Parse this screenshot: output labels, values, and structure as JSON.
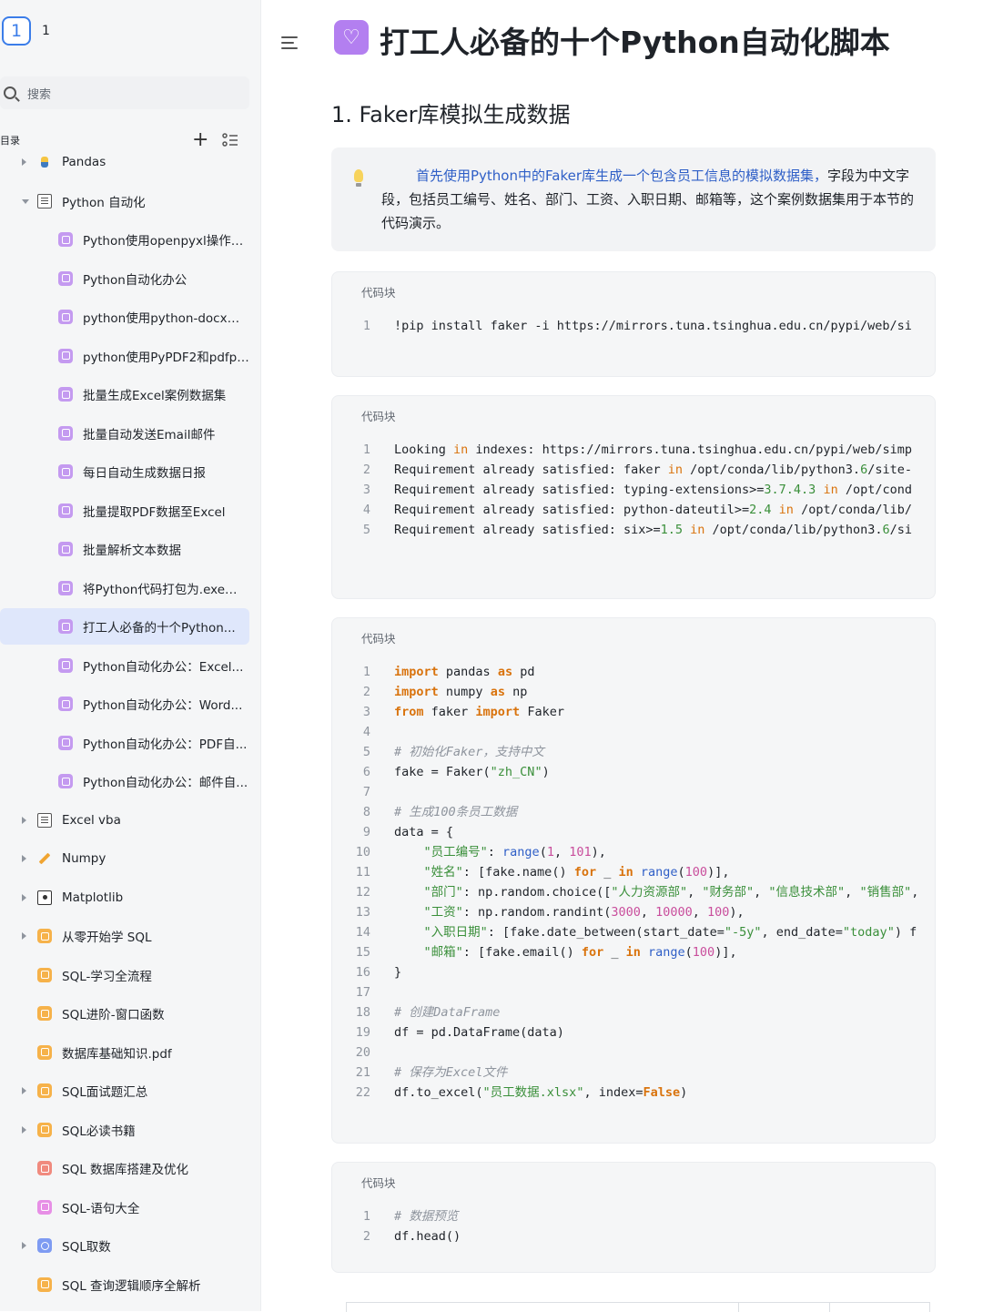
{
  "workspace": {
    "badge": "1",
    "name": "1"
  },
  "search": {
    "placeholder": "搜索"
  },
  "directory": {
    "label": "目录"
  },
  "tree": [
    {
      "label": "Pandas",
      "icon": "python-icon",
      "arrow": "right",
      "indent": 0
    },
    {
      "label": "Python 自动化",
      "icon": "doc-icon",
      "arrow": "down",
      "indent": 0
    },
    {
      "label": "Python使用openpyxl操作e...",
      "icon": "purple-page-icon",
      "indent": 1
    },
    {
      "label": "Python自动化办公",
      "icon": "purple-page-icon",
      "indent": 1
    },
    {
      "label": "python使用python-docx操...",
      "icon": "purple-page-icon",
      "indent": 1
    },
    {
      "label": "python使用PyPDF2和pdfpl...",
      "icon": "purple-page-icon",
      "indent": 1
    },
    {
      "label": "批量生成Excel案例数据集",
      "icon": "purple-page-icon",
      "indent": 1
    },
    {
      "label": "批量自动发送Email邮件",
      "icon": "purple-page-icon",
      "indent": 1
    },
    {
      "label": "每日自动生成数据日报",
      "icon": "purple-page-icon",
      "indent": 1
    },
    {
      "label": "批量提取PDF数据至Excel",
      "icon": "purple-page-icon",
      "indent": 1
    },
    {
      "label": "批量解析文本数据",
      "icon": "purple-page-icon",
      "indent": 1
    },
    {
      "label": "将Python代码打包为.exe程序",
      "icon": "purple-page-icon",
      "indent": 1
    },
    {
      "label": "打工人必备的十个Python...",
      "icon": "purple-page-icon",
      "indent": 1,
      "active": true
    },
    {
      "label": "Python自动化办公：Excel...",
      "icon": "purple-page-icon",
      "indent": 1
    },
    {
      "label": "Python自动化办公：Word...",
      "icon": "purple-page-icon",
      "indent": 1
    },
    {
      "label": "Python自动化办公：PDF自...",
      "icon": "purple-page-icon",
      "indent": 1
    },
    {
      "label": "Python自动化办公：邮件自...",
      "icon": "purple-page-icon",
      "indent": 1
    },
    {
      "label": "Excel vba",
      "icon": "doc-icon",
      "arrow": "right",
      "indent": 0
    },
    {
      "label": "Numpy",
      "icon": "pencil-icon",
      "arrow": "right",
      "indent": 0
    },
    {
      "label": "Matplotlib",
      "icon": "image-icon",
      "arrow": "right",
      "indent": 0
    },
    {
      "label": "从零开始学 SQL",
      "icon": "orange-page-icon",
      "arrow": "right",
      "indent": 0
    },
    {
      "label": "SQL-学习全流程",
      "icon": "orange-page-icon",
      "indent": 0
    },
    {
      "label": "SQL进阶-窗口函数",
      "icon": "orange-page-icon",
      "indent": 0
    },
    {
      "label": "数据库基础知识.pdf",
      "icon": "orange-page-icon",
      "indent": 0
    },
    {
      "label": "SQL面试题汇总",
      "icon": "orange-page-icon",
      "arrow": "right",
      "indent": 0
    },
    {
      "label": "SQL必读书籍",
      "icon": "orange-page-icon",
      "arrow": "right",
      "indent": 0
    },
    {
      "label": "SQL 数据库搭建及优化",
      "icon": "red-page-icon",
      "indent": 0
    },
    {
      "label": "SQL-语句大全",
      "icon": "pink-page-icon",
      "indent": 0
    },
    {
      "label": "SQL取数",
      "icon": "blue-page-icon",
      "arrow": "right",
      "indent": 0
    },
    {
      "label": "SQL 查询逻辑顺序全解析",
      "icon": "orange-page-icon",
      "indent": 0
    }
  ],
  "page": {
    "title": "打工人必备的十个Python自动化脚本",
    "heading": "1. Faker库模拟生成数据",
    "callout_highlight": "首先使用Python中的Faker库生成一个包含员工信息的模拟数据集，",
    "callout_rest": "字段为中文字段，包括员工编号、姓名、部门、工资、入职日期、邮箱等，这个案例数据集用于本节的代码演示。"
  },
  "code_caption": "代码块",
  "code_blocks": [
    {
      "lines": [
        "!pip install faker -i https://mirrors.tuna.tsinghua.edu.cn/pypi/web/si"
      ]
    },
    {
      "lines": [
        "Looking in indexes: https://mirrors.tuna.tsinghua.edu.cn/pypi/web/simp",
        "Requirement already satisfied: faker in /opt/conda/lib/python3.6/site-",
        "Requirement already satisfied: typing-extensions>=3.7.4.3 in /opt/cond",
        "Requirement already satisfied: python-dateutil>=2.4 in /opt/conda/lib/",
        "Requirement already satisfied: six>=1.5 in /opt/conda/lib/python3.6/si"
      ]
    },
    {
      "lines": [
        "import pandas as pd",
        "import numpy as np",
        "from faker import Faker",
        "",
        "# 初始化Faker，支持中文",
        "fake = Faker(\"zh_CN\")",
        "",
        "# 生成100条员工数据",
        "data = {",
        "    \"员工编号\": range(1, 101),",
        "    \"姓名\": [fake.name() for _ in range(100)],",
        "    \"部门\": np.random.choice([\"人力资源部\", \"财务部\", \"信息技术部\", \"销售部\",",
        "    \"工资\": np.random.randint(3000, 10000, 100),",
        "    \"入职日期\": [fake.date_between(start_date=\"-5y\", end_date=\"today\") f",
        "    \"邮箱\": [fake.email() for _ in range(100)],",
        "}",
        "",
        "# 创建DataFrame",
        "df = pd.DataFrame(data)",
        "",
        "# 保存为Excel文件",
        "df.to_excel(\"员工数据.xlsx\", index=False)"
      ]
    },
    {
      "lines": [
        "# 数据预览",
        "df.head()"
      ]
    }
  ]
}
